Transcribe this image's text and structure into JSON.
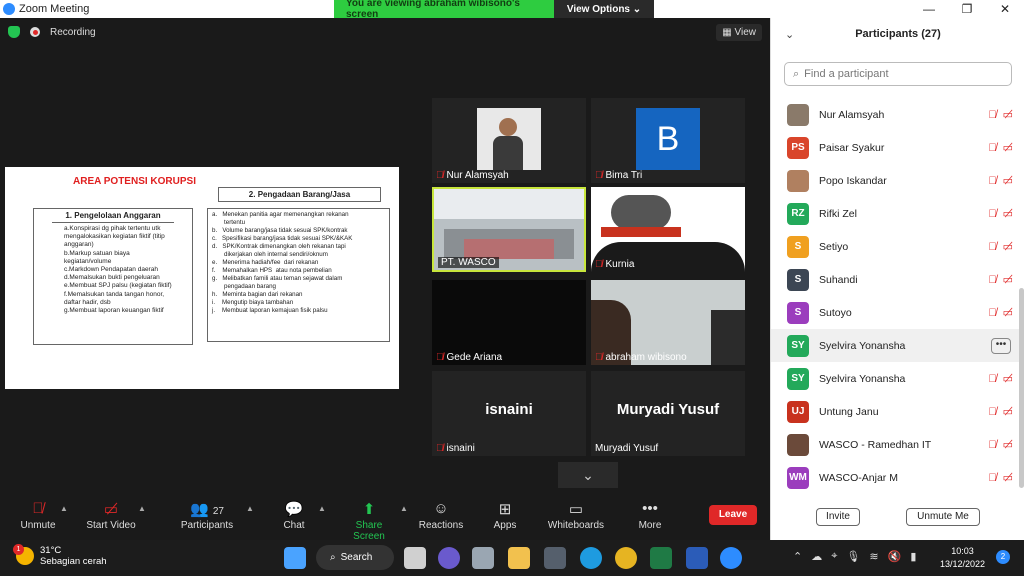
{
  "window": {
    "title": "Zoom Meeting",
    "controls": [
      "—",
      "❐",
      "✕"
    ]
  },
  "share_banner": {
    "viewing_text": "You are viewing abraham wibisono's screen",
    "view_options": "View Options"
  },
  "topbar": {
    "recording": "Recording",
    "view": "View"
  },
  "slide": {
    "title": "AREA POTENSI KORUPSI",
    "box1_title": "1. Pengelolaan Anggaran",
    "box1_items": [
      "a.Konspirasi dg pihak tertentu utk",
      "mengalokasikan kegiatan fiktif (titip",
      "anggaran)",
      "b.Markup satuan biaya",
      "kegiatan/volume",
      "c.Markdown Pendapatan daerah",
      "d.Memalsukan bukti pengeluaran",
      "e.Membuat SPJ palsu (kegiatan fiktif)",
      "f.Memalsukan tanda tangan honor,",
      "daftar  hadir, dsb",
      "g.Membuat laporan keuangan fiktif"
    ],
    "box2_title": "2. Pengadaan Barang/Jasa",
    "box2_items": [
      "a.   Menekan panitia agar memenangkan rekanan",
      "       tertentu",
      "b.   Volume barang/jasa tidak sesuai SPK/kontrak",
      "c.   Spesifikasi barang/jasa tidak sesuai SPK/&KAK",
      "d.   SPK/Kontrak dimenangkan oleh rekanan tapi",
      "       dikerjakan oleh internal sendiri/oknum",
      "e.   Menerima hadiah/fee  dari rekanan",
      "f.    Memahalkan HPS  atau nota pembelian",
      "g.   Melibatkan famili atau teman sejawat dalam",
      "       pengadaan barang",
      "h.   Meminta bagian dari rekanan",
      "i.    Mengutip biaya tambahan",
      "j.    Membuat laporan kemajuan fisik palsu"
    ]
  },
  "tiles": [
    {
      "name": "Nur Alamsyah",
      "muted": true
    },
    {
      "name": "Bima Tri",
      "muted": true,
      "letter": "B"
    },
    {
      "name": "PT. WASCO",
      "muted": false
    },
    {
      "name": "Kurnia",
      "muted": true
    },
    {
      "name": "Gede Ariana",
      "muted": true
    },
    {
      "name": "abraham wibisono",
      "muted": true
    },
    {
      "name": "isnaini",
      "muted": true,
      "big": "isnaini"
    },
    {
      "name": "Muryadi Yusuf",
      "muted": false,
      "big": "Muryadi Yusuf"
    }
  ],
  "toolbar": {
    "unmute": "Unmute",
    "start_video": "Start Video",
    "participants": "Participants",
    "participants_count": "27",
    "chat": "Chat",
    "share_screen": "Share Screen",
    "reactions": "Reactions",
    "apps": "Apps",
    "whiteboards": "Whiteboards",
    "more": "More",
    "leave": "Leave"
  },
  "panel": {
    "title": "Participants (27)",
    "search_placeholder": "Find a participant",
    "participants": [
      {
        "name": "Nur Alamsyah",
        "initials": "",
        "color": "#8a7a6a"
      },
      {
        "name": "Paisar Syakur",
        "initials": "PS",
        "color": "#d9452b"
      },
      {
        "name": "Popo Iskandar",
        "initials": "",
        "color": "#b08060"
      },
      {
        "name": "Rifki Zel",
        "initials": "RZ",
        "color": "#23a95a"
      },
      {
        "name": "Setiyo",
        "initials": "S",
        "color": "#f0a020"
      },
      {
        "name": "Suhandi",
        "initials": "S",
        "color": "#3c4654"
      },
      {
        "name": "Sutoyo",
        "initials": "S",
        "color": "#9b3dbd"
      },
      {
        "name": "Syelvira Yonansha",
        "initials": "SY",
        "color": "#23a95a"
      },
      {
        "name": "Syelvira Yonansha",
        "initials": "SY",
        "color": "#23a95a"
      },
      {
        "name": "Untung Janu",
        "initials": "UJ",
        "color": "#c8321e"
      },
      {
        "name": "WASCO - Ramedhan IT",
        "initials": "",
        "color": "#6b4a3a"
      },
      {
        "name": "WASCO-Anjar M",
        "initials": "WM",
        "color": "#9b3dbd"
      }
    ],
    "invite": "Invite",
    "unmute_me": "Unmute Me"
  },
  "taskbar": {
    "temp": "31°C",
    "weather": "Sebagian cerah",
    "weather_badge": "1",
    "search": "Search",
    "time": "10:03",
    "date": "13/12/2022",
    "notifications": "2"
  }
}
